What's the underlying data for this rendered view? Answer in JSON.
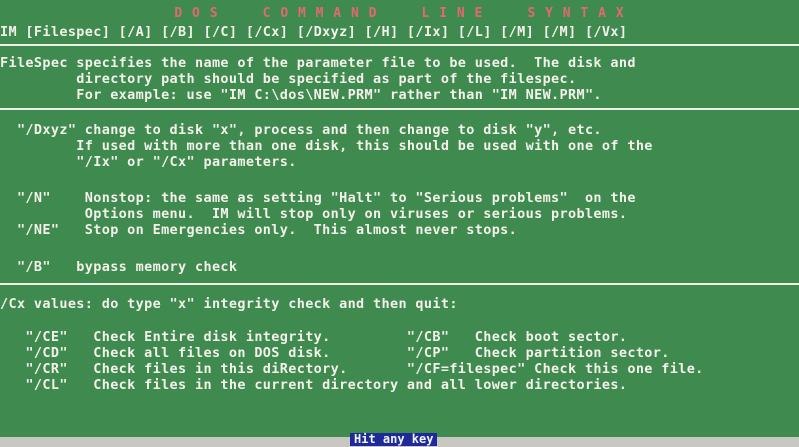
{
  "title": "D O S     C O M M A N D     L I N E     S Y N T A X",
  "syntax": "IM [Filespec] [/A] [/B] [/C] [/Cx] [/Dxyz] [/H] [/Ix] [/L] [/M] [/M] [/Vx]",
  "filespec": [
    "FileSpec specifies the name of the parameter file to be used.  The disk and",
    "         directory path should be specified as part of the filespec.",
    "         For example: use \"IM C:\\dos\\NEW.PRM\" rather than \"IM NEW.PRM\"."
  ],
  "dxyz": [
    "  \"/Dxyz\" change to disk \"x\", process and then change to disk \"y\", etc.",
    "         If used with more than one disk, this should be used with one of the",
    "         \"/Ix\" or \"/Cx\" parameters."
  ],
  "nonstop": [
    "  \"/N\"    Nonstop: the same as setting \"Halt\" to \"Serious problems\"  on the",
    "          Options menu.  IM will stop only on viruses or serious problems.",
    "  \"/NE\"   Stop on Emergencies only.  This almost never stops."
  ],
  "bypass": "  \"/B\"   bypass memory check",
  "cx_header": "/Cx values: do type \"x\" integrity check and then quit:",
  "cx_rows": [
    "   \"/CE\"   Check Entire disk integrity.         \"/CB\"   Check boot sector.",
    "   \"/CD\"   Check all files on DOS disk.         \"/CP\"   Check partition sector.",
    "   \"/CR\"   Check files in this diRectory.       \"/CF=filespec\" Check this one file.",
    "   \"/CL\"   Check files in the current directory and all lower directories."
  ],
  "prompt": "Hit any key"
}
